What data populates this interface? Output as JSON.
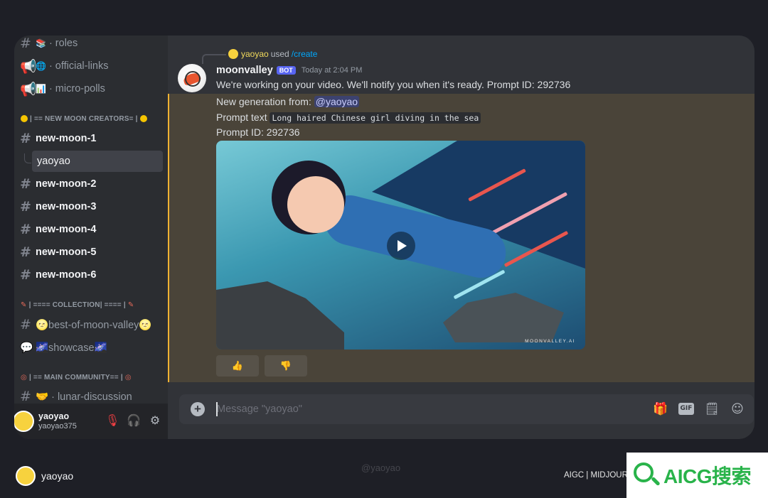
{
  "sidebar": {
    "channels_top": [
      {
        "emoji": "📚",
        "label": "· roles"
      },
      {
        "emoji": "🌐",
        "label": "· official-links"
      },
      {
        "emoji": "📊",
        "label": "· micro-polls"
      }
    ],
    "category_new_moon": "| == NEW MOON CREATORS= |",
    "new_moon_channels": [
      "new-moon-1",
      "new-moon-2",
      "new-moon-3",
      "new-moon-4",
      "new-moon-5",
      "new-moon-6"
    ],
    "thread": "yaoyao",
    "category_collection": "| ==== COLLECTION| ==== |",
    "best_of": "🌝best-of-moon-valley🌝",
    "showcase": "🌌showcase🌌",
    "category_main": "| == MAIN COMMUNITY== |",
    "lunar_discussion": "🤝 · lunar-discussion"
  },
  "user": {
    "name": "yaoyao",
    "handle": "yaoyao375"
  },
  "message": {
    "replied_user": "yaoyao",
    "replied_used": "used",
    "replied_command": "/create",
    "author": "moonvalley",
    "bot_tag": "BOT",
    "timestamp": "Today at 2:04 PM",
    "text": "We're working on your video. We'll notify you when it's ready. Prompt ID: 292736",
    "gen_from_label": "New generation from:",
    "mention": "@yaoyao",
    "prompt_label": "Prompt text",
    "prompt_text": "Long haired Chinese girl diving in the sea",
    "prompt_id": "Prompt ID: 292736",
    "media_watermark": "MOONVALLEY.AI",
    "reaction_up": "👍",
    "reaction_down": "👎"
  },
  "composer": {
    "placeholder": "Message \"yaoyao\""
  },
  "footer": {
    "name": "yaoyao",
    "watermark": "@yaoyao",
    "right_text": "AIGC | MIDJOUR",
    "logo_text": "AICG搜索"
  }
}
